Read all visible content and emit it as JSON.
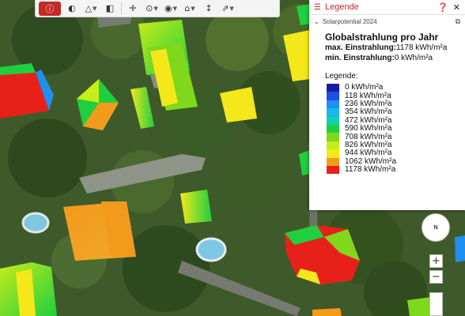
{
  "toolbar": {
    "tools": [
      {
        "icon": "info-icon",
        "glyph": "ⓘ",
        "active": true
      },
      {
        "icon": "shading-icon",
        "glyph": "◐"
      },
      {
        "icon": "measure-triangle-icon",
        "glyph": "△",
        "caret": true
      },
      {
        "icon": "panel-toggle-icon",
        "glyph": "◧"
      },
      {
        "icon": "crosshair-icon",
        "glyph": "✛"
      },
      {
        "icon": "location-pin-icon",
        "glyph": "⊙",
        "caret": true
      },
      {
        "icon": "eye-icon",
        "glyph": "◉",
        "caret": true
      },
      {
        "icon": "building-icon",
        "glyph": "⌂",
        "caret": true
      },
      {
        "icon": "profile-icon",
        "glyph": "↕"
      },
      {
        "icon": "view-3d-icon",
        "glyph": "⇗",
        "caret": true
      }
    ]
  },
  "legend_panel": {
    "title": "Legende",
    "layer_name": "Solarpotential 2024",
    "heading": "Globalstrahlung pro Jahr",
    "max_label": "max. Einstrahlung:",
    "max_value": "1178 kWh/m²a",
    "min_label": "min. Einstrahlung:",
    "min_value": "0 kWh/m²a",
    "legend_title": "Legende:",
    "entries": [
      {
        "label": "0 kWh/m²a",
        "color": "#1a1aaa"
      },
      {
        "label": "118 kWh/m²a",
        "color": "#1f4fe0"
      },
      {
        "label": "236 kWh/m²a",
        "color": "#1f8ff0"
      },
      {
        "label": "354 kWh/m²a",
        "color": "#18b8e8"
      },
      {
        "label": "472 kWh/m²a",
        "color": "#16cfb0"
      },
      {
        "label": "590 kWh/m²a",
        "color": "#1fcf3f"
      },
      {
        "label": "708 kWh/m²a",
        "color": "#7fd81c"
      },
      {
        "label": "826 kWh/m²a",
        "color": "#c7ec18"
      },
      {
        "label": "944 kWh/m²a",
        "color": "#f4e81a"
      },
      {
        "label": "1062 kWh/m²a",
        "color": "#f29a1c"
      },
      {
        "label": "1178 kWh/m²a",
        "color": "#e8201a"
      }
    ]
  },
  "map_controls": {
    "compass_label": "N",
    "zoom_in": "+",
    "zoom_out": "−"
  }
}
